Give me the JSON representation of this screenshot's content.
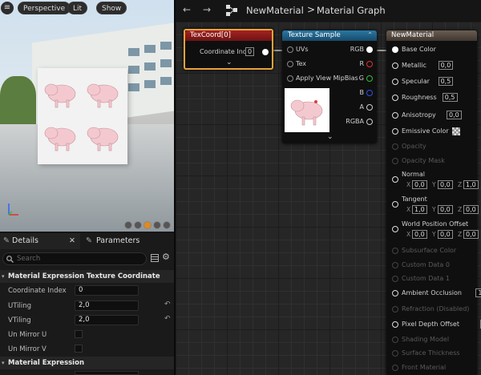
{
  "viewport": {
    "perspective": "Perspective",
    "lit": "Lit",
    "show": "Show"
  },
  "details": {
    "tabs": [
      {
        "label": "Details"
      },
      {
        "label": "Parameters"
      }
    ],
    "search_placeholder": "Search",
    "section1": "Material Expression Texture Coordinate",
    "props": [
      {
        "label": "Coordinate Index",
        "value": "0"
      },
      {
        "label": "UTiling",
        "value": "2,0"
      },
      {
        "label": "VTiling",
        "value": "2,0"
      },
      {
        "label": "Un Mirror U",
        "value": ""
      },
      {
        "label": "Un Mirror V",
        "value": ""
      }
    ],
    "section2": "Material Expression"
  },
  "toolbar": {
    "material_name": "NewMaterial",
    "separator": ">",
    "graph_name": "Material Graph"
  },
  "texcoord": {
    "title": "TexCoord[0]",
    "pin_label": "Coordinate Index",
    "pin_value": "0"
  },
  "texsample": {
    "title": "Texture Sample",
    "inputs": [
      "UVs",
      "Tex",
      "Apply View MipBias"
    ],
    "outputs": [
      "RGB",
      "R",
      "G",
      "B",
      "A",
      "RGBA"
    ]
  },
  "material": {
    "title": "NewMaterial",
    "pins": [
      {
        "label": "Base Color",
        "active": true
      },
      {
        "label": "Metallic",
        "active": true,
        "value": "0,0"
      },
      {
        "label": "Specular",
        "active": true,
        "value": "0,5"
      },
      {
        "label": "Roughness",
        "active": true,
        "value": "0,5"
      },
      {
        "label": "Anisotropy",
        "active": true,
        "value": "0,0"
      },
      {
        "label": "Emissive Color",
        "active": true
      },
      {
        "label": "Opacity",
        "active": false
      },
      {
        "label": "Opacity Mask",
        "active": false
      }
    ],
    "normal": {
      "label": "Normal",
      "x": "0,0",
      "y": "0,0",
      "z": "1,0"
    },
    "tangent": {
      "label": "Tangent",
      "x": "1,0",
      "y": "0,0",
      "z": "0,0"
    },
    "wpo": {
      "label": "World Position Offset",
      "x": "0,0",
      "y": "0,0",
      "z": "0,0"
    },
    "pins2": [
      {
        "label": "Subsurface Color",
        "active": false
      },
      {
        "label": "Custom Data 0",
        "active": false
      },
      {
        "label": "Custom Data 1",
        "active": false
      },
      {
        "label": "Ambient Occlusion",
        "active": true,
        "value": "1,0"
      },
      {
        "label": "Refraction (Disabled)",
        "active": false
      },
      {
        "label": "Pixel Depth Offset",
        "active": true,
        "value": "0,0"
      },
      {
        "label": "Shading Model",
        "active": false
      },
      {
        "label": "Surface Thickness",
        "active": false
      },
      {
        "label": "Front Material",
        "active": false
      }
    ],
    "axis": {
      "x": "X",
      "y": "Y",
      "z": "Z"
    }
  },
  "colors": {
    "texcoord_header": "#8c1a1a",
    "texsample_header": "#1f5e83",
    "material_header": "#5a4c42",
    "selection": "#e8a33a",
    "r": "#e03030",
    "g": "#30c030",
    "b": "#3050e0"
  }
}
